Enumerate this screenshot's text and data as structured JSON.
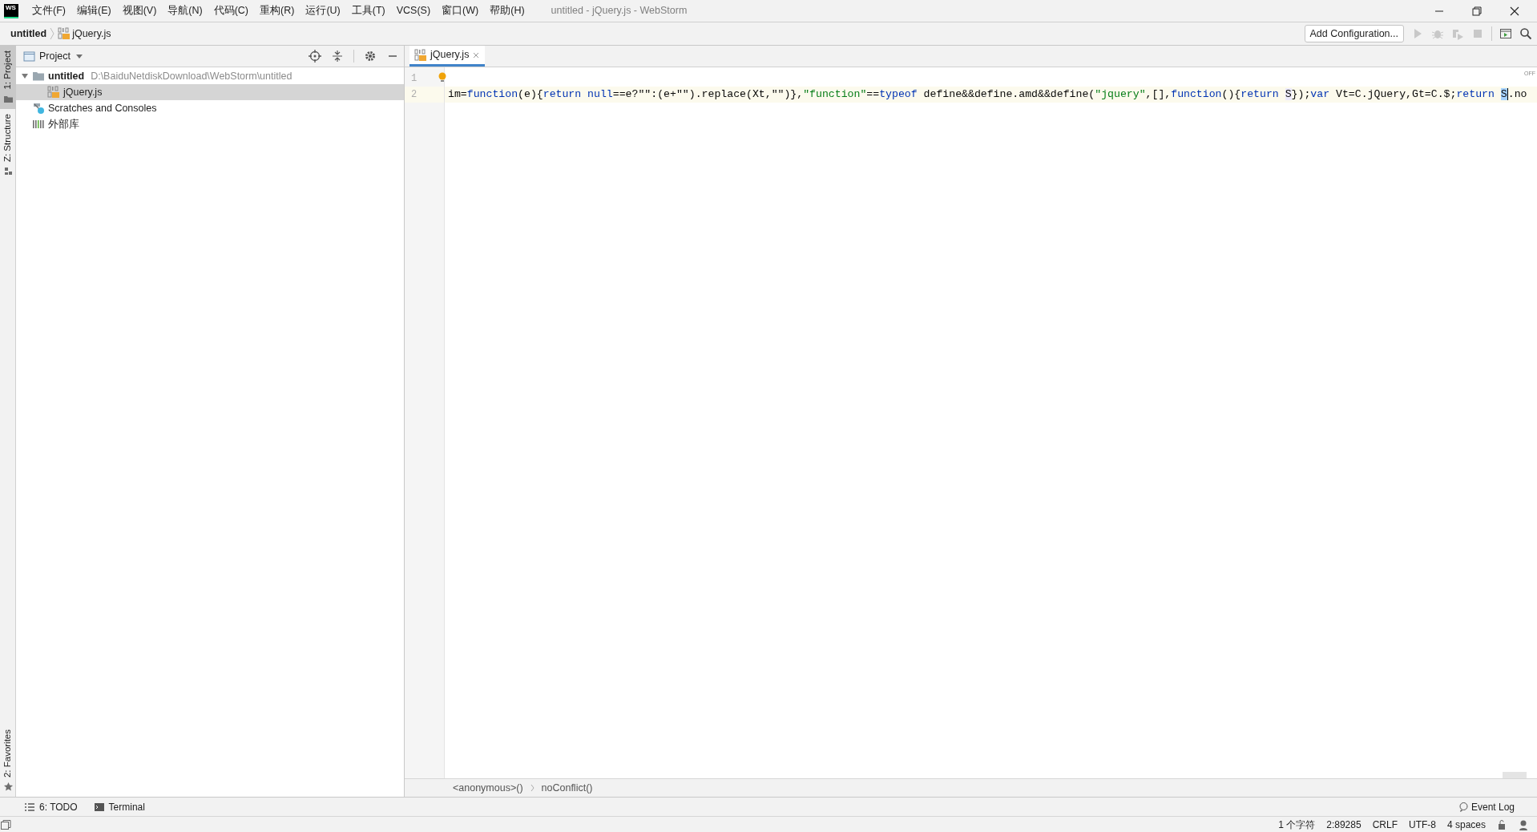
{
  "title_bar": {
    "app_logo": "WS",
    "menus": [
      "文件(F)",
      "编辑(E)",
      "视图(V)",
      "导航(N)",
      "代码(C)",
      "重构(R)",
      "运行(U)",
      "工具(T)",
      "VCS(S)",
      "窗口(W)",
      "帮助(H)"
    ],
    "title": "untitled - jQuery.js - WebStorm"
  },
  "nav_bar": {
    "breadcrumbs": [
      {
        "label": "untitled",
        "kind": "project"
      },
      {
        "label": "jQuery.js",
        "kind": "js"
      }
    ],
    "run_config": "Add Configuration..."
  },
  "left_strip": {
    "top": [
      {
        "label": "1: Project",
        "kind": "folder",
        "selected": true
      },
      {
        "label": "Z: Structure",
        "kind": "structure",
        "selected": false
      }
    ],
    "bottom": [
      {
        "label": "2: Favorites",
        "kind": "star",
        "selected": false
      }
    ]
  },
  "project_panel": {
    "title": "Project",
    "tree": [
      {
        "label": "untitled",
        "path": "D:\\BaiduNetdiskDownload\\WebStorm\\untitled",
        "kind": "folder",
        "expanded": true,
        "selected": false,
        "children": [
          {
            "label": "jQuery.js",
            "kind": "js",
            "selected": true
          }
        ]
      },
      {
        "label": "Scratches and Consoles",
        "kind": "scratches",
        "selected": false
      },
      {
        "label": "外部库",
        "kind": "library",
        "selected": false
      }
    ]
  },
  "editor": {
    "tabs": [
      {
        "label": "jQuery.js",
        "selected": true
      }
    ],
    "badge": "OFF",
    "lines": [
      {
        "number": "1",
        "intention_bulb": true,
        "current": false
      },
      {
        "number": "2",
        "intention_bulb": false,
        "current": true,
        "tokens": [
          {
            "text": "im=",
            "kind": "plain"
          },
          {
            "text": "function",
            "kind": "keyword"
          },
          {
            "text": "(e){",
            "kind": "plain"
          },
          {
            "text": "return",
            "kind": "keyword"
          },
          {
            "text": " null",
            "kind": "keyword"
          },
          {
            "text": "==e?\"\":(e+\"\").replace(Xt,\"\")},",
            "kind": "plain"
          },
          {
            "text": "\"function\"",
            "kind": "string"
          },
          {
            "text": "==",
            "kind": "plain"
          },
          {
            "text": "typeof",
            "kind": "keyword"
          },
          {
            "text": " define&&define.amd&&define(",
            "kind": "plain"
          },
          {
            "text": "\"jquery\"",
            "kind": "string"
          },
          {
            "text": ",[],",
            "kind": "plain"
          },
          {
            "text": "function",
            "kind": "keyword"
          },
          {
            "text": "(){",
            "kind": "plain"
          },
          {
            "text": "return ",
            "kind": "keyword"
          },
          {
            "text": "S",
            "kind": "usage"
          },
          {
            "text": "});",
            "kind": "plain"
          },
          {
            "text": "var",
            "kind": "keyword"
          },
          {
            "text": " Vt=C.jQuery,Gt=C.$;",
            "kind": "plain"
          },
          {
            "text": "return ",
            "kind": "keyword"
          },
          {
            "text": "S",
            "kind": "caret"
          },
          {
            "text": ".no",
            "kind": "plain"
          }
        ]
      }
    ],
    "breadcrumbs": [
      "<anonymous>()",
      "noConflict()"
    ]
  },
  "bottom_tools": [
    {
      "label": "6: TODO",
      "kind": "list"
    },
    {
      "label": "Terminal",
      "kind": "terminal"
    }
  ],
  "event_log": "Event Log",
  "status_bar": [
    "1 个字符",
    "2:89285",
    "CRLF",
    "UTF-8",
    "4 spaces"
  ]
}
